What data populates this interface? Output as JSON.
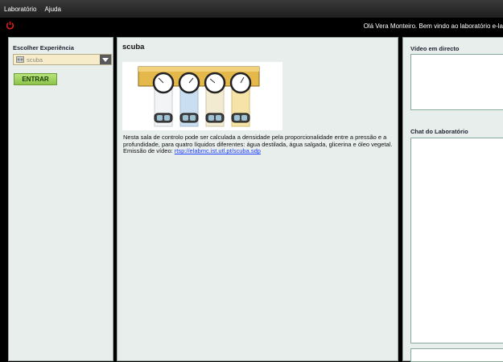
{
  "menu": {
    "items": [
      {
        "label": "Laboratório"
      },
      {
        "label": "Ajuda"
      }
    ]
  },
  "topbar": {
    "welcome": "Olá Vera Monteiro. Bem vindo ao laboratório e-la",
    "power_icon": "power-icon",
    "power_color": "#d42020"
  },
  "left": {
    "label": "Escolher Experiência",
    "select_value": "scuba",
    "enter_label": "ENTRAR"
  },
  "main": {
    "title": "scuba",
    "description": "Nesta sala de controlo pode ser calculada a densidade pela proporcionalidade entre a pressão e a profundidade, para quatro líquidos diferentes: água destilada, água salgada, glicerina e óleo vegetal.",
    "video_label": "Emissão de vídeo:",
    "video_link": "rtsp://elabmc.ist.utl.pt/scuba.sdp"
  },
  "right": {
    "video_title": "Vídeo em directo",
    "chat_title": "Chat do Laboratório"
  },
  "colors": {
    "accent_green": "#8cc34a",
    "select_bg": "#f7ecc9",
    "panel_bg": "#e8eeec"
  }
}
